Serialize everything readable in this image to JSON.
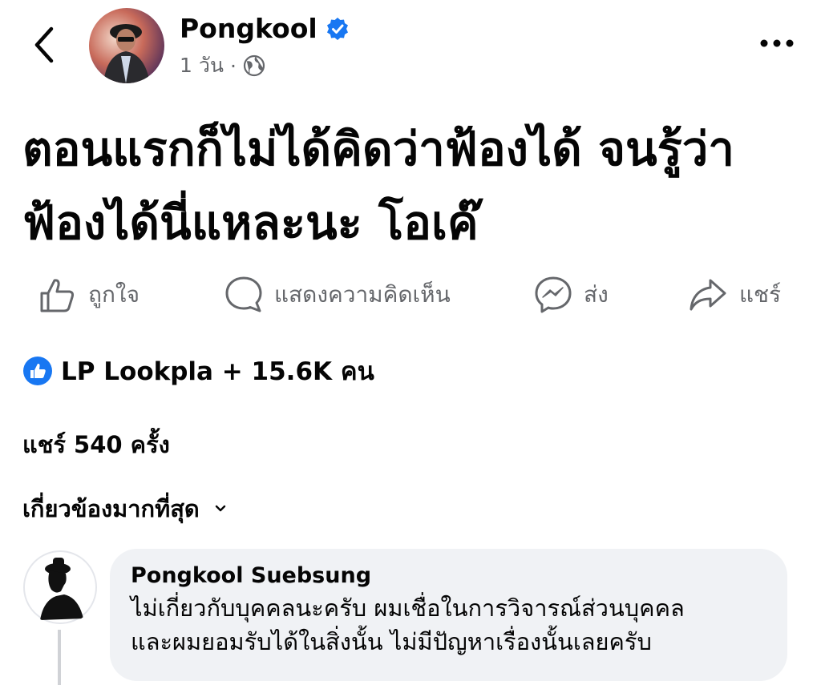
{
  "header": {
    "author": "Pongkool",
    "time": "1 วัน",
    "separator": "·",
    "verified_icon": "verified-badge-icon",
    "privacy_icon": "globe-icon"
  },
  "post": {
    "text_line1": "ตอนแรกก็ไม่ได้คิดว่าฟ้องได้ จนรู้ว่า",
    "text_line2": "ฟ้องได้นี่แหละนะ โอเค๊"
  },
  "actions": {
    "like": "ถูกใจ",
    "comment": "แสดงความคิดเห็น",
    "send": "ส่ง",
    "share": "แชร์"
  },
  "reactions": {
    "summary": "LP Lookpla + 15.6K คน"
  },
  "shares": {
    "text": "แชร์ 540 ครั้ง"
  },
  "sort": {
    "label": "เกี่ยวข้องมากที่สุด"
  },
  "comment": {
    "author": "Pongkool Suebsung",
    "line1": "ไม่เกี่ยวกับบุคคลนะครับ ผมเชื่อในการวิจารณ์ส่วนบุคคล",
    "line2": "และผมยอมรับได้ในสิ่งนั้น  ไม่มีปัญหาเรื่องนั้นเลยครับ"
  },
  "colors": {
    "accent": "#1877f2",
    "muted": "#65676b",
    "bubble": "#f0f2f5"
  }
}
